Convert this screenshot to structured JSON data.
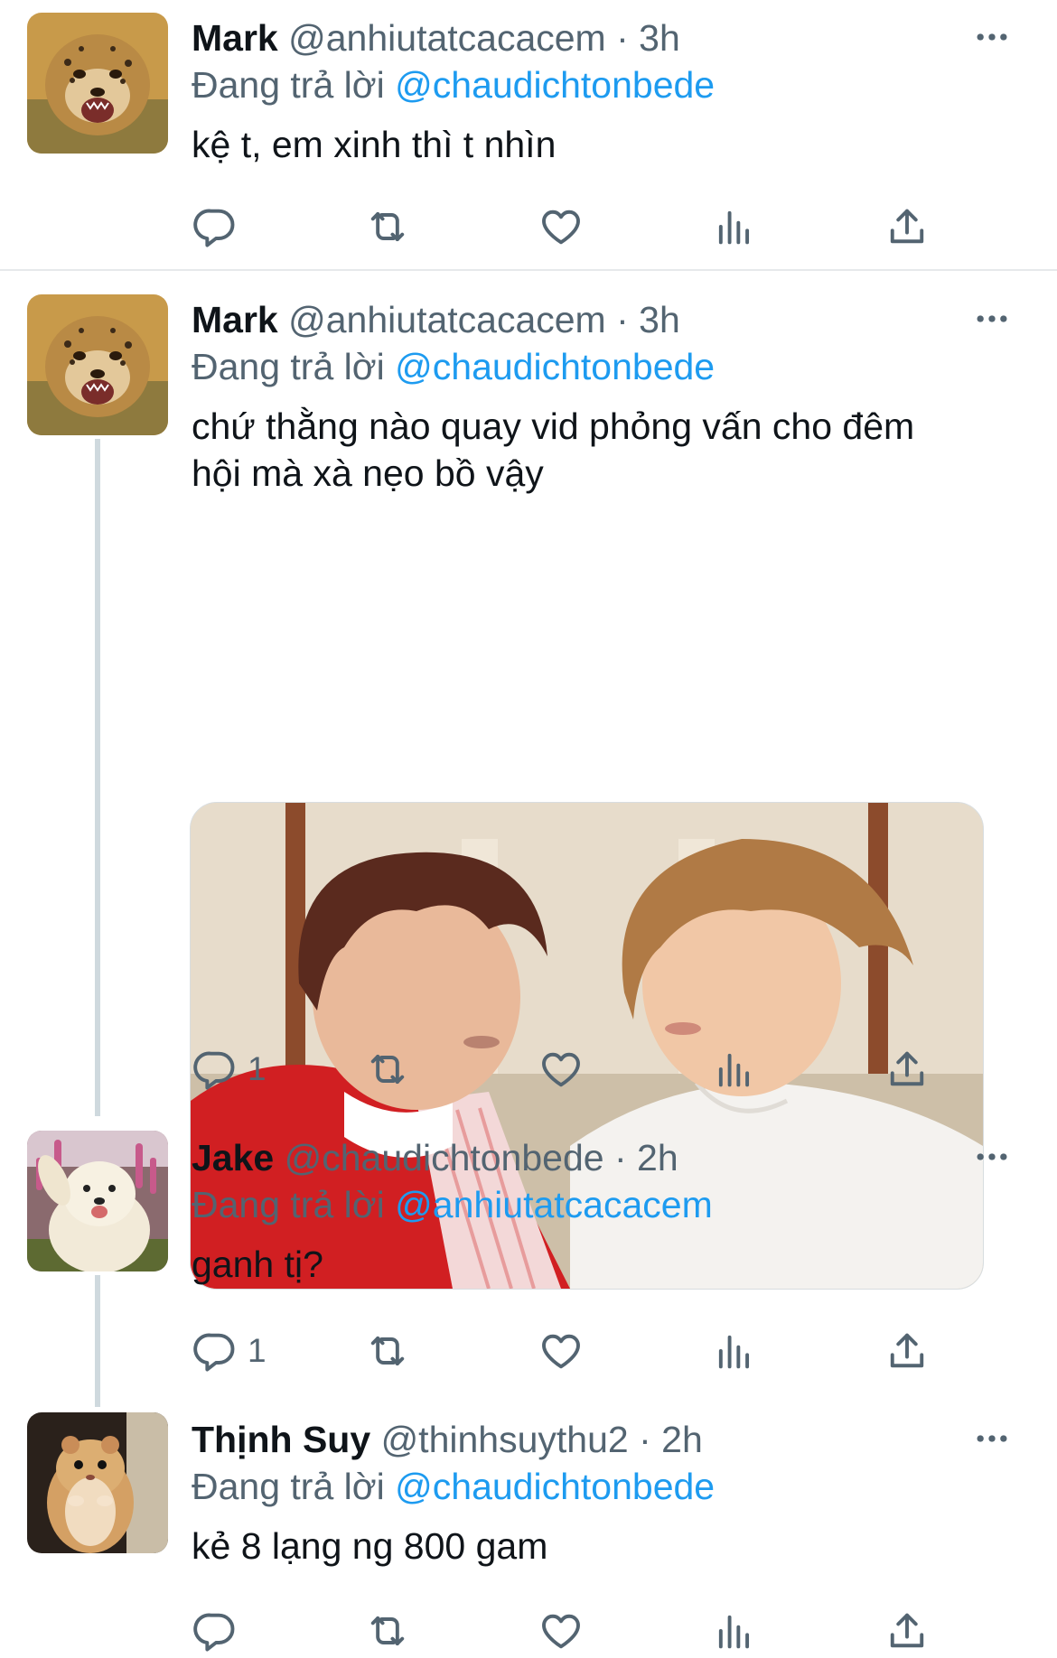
{
  "tweets": [
    {
      "name": "Mark",
      "handle": "@anhiutatcacacem",
      "time": "3h",
      "reply_prefix": "Đang trả lời",
      "reply_to": "@chaudichtonbede",
      "text": "kệ t, em xinh thì t nhìn",
      "reply_count": "",
      "avatar": "cheetah-cub"
    },
    {
      "name": "Mark",
      "handle": "@anhiutatcacacem",
      "time": "3h",
      "reply_prefix": "Đang trả lời",
      "reply_to": "@chaudichtonbede",
      "text_line1": "chứ thằng nào quay vid phỏng vấn cho đêm",
      "text_line2": "hội mà xà nẹo bồ vậy",
      "reply_count": "1",
      "avatar": "cheetah-cub",
      "media": "photo of two young men looking at each other"
    },
    {
      "name": "Jake",
      "handle": "@chaudichtonbede",
      "time": "2h",
      "reply_prefix": "Đang trả lời",
      "reply_to": "@anhiutatcacacem",
      "text": "ganh tị?",
      "reply_count": "1",
      "avatar": "samoyed-dog"
    },
    {
      "name": "Thịnh Suy",
      "handle": "@thinhsuythu2",
      "time": "2h",
      "reply_prefix": "Đang trả lời",
      "reply_to": "@chaudichtonbede",
      "text": "kẻ 8 lạng ng 800 gam",
      "reply_count": "",
      "avatar": "hamster"
    }
  ],
  "separator": " · ",
  "icons": [
    "reply-icon",
    "retweet-icon",
    "like-icon",
    "views-icon",
    "share-icon",
    "more-icon"
  ],
  "colors": {
    "mention": "#1d9bf0",
    "secondary_text": "#536471",
    "divider": "#e6e9eb",
    "thread_line": "#cfd9de"
  }
}
